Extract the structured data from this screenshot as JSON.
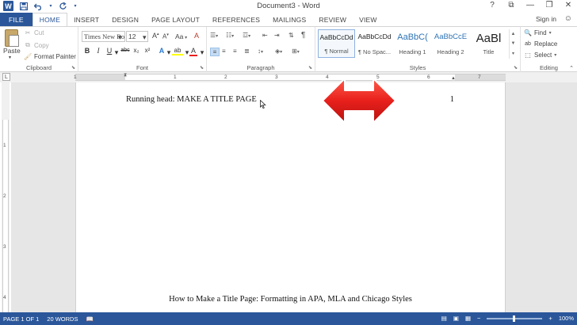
{
  "window": {
    "title": "Document3 - Word",
    "controls": {
      "help": "?",
      "ribbon_display": "⧉",
      "minimize": "—",
      "restore": "❐",
      "close": "✕"
    }
  },
  "quick_access": {
    "app_icon": "W",
    "save_icon": "save-icon",
    "undo_icon": "undo-icon",
    "redo_icon": "redo-icon",
    "customize_icon": "chevron-down-icon"
  },
  "tabs": [
    "FILE",
    "HOME",
    "INSERT",
    "DESIGN",
    "PAGE LAYOUT",
    "REFERENCES",
    "MAILINGS",
    "REVIEW",
    "VIEW"
  ],
  "active_tab": "HOME",
  "sign_in": "Sign in",
  "ribbon": {
    "clipboard": {
      "label": "Clipboard",
      "paste": "Paste",
      "cut": "Cut",
      "copy": "Copy",
      "format_painter": "Format Painter"
    },
    "font": {
      "label": "Font",
      "name": "Times New Ro",
      "size": "12",
      "grow": "A",
      "shrink": "A",
      "case": "Aa",
      "clear": "A",
      "bold": "B",
      "italic": "I",
      "underline": "U",
      "strike": "abc",
      "subscript": "x₂",
      "superscript": "x²",
      "effects": "A",
      "highlight": "ab",
      "color": "A"
    },
    "paragraph": {
      "label": "Paragraph",
      "pilcrow": "¶"
    },
    "styles": {
      "label": "Styles",
      "items": [
        {
          "preview": "AaBbCcDd",
          "name": "¶ Normal"
        },
        {
          "preview": "AaBbCcDd",
          "name": "¶ No Spac..."
        },
        {
          "preview": "AaBbC(",
          "name": "Heading 1"
        },
        {
          "preview": "AaBbCcE",
          "name": "Heading 2"
        },
        {
          "preview": "AaBl",
          "name": "Title"
        }
      ]
    },
    "editing": {
      "label": "Editing",
      "find": "Find",
      "replace": "Replace",
      "select": "Select"
    }
  },
  "ruler": {
    "tab_selector": "L",
    "numbers": [
      "1",
      "1",
      "2",
      "3",
      "4",
      "5",
      "6",
      "7"
    ],
    "vertical_numbers": [
      "1",
      "2",
      "3",
      "4"
    ]
  },
  "document": {
    "header_text": "Running head: MAKE A TITLE PAGE",
    "page_number": "1",
    "title_text": "How to Make a Title Page: Formatting in APA, MLA and Chicago Styles"
  },
  "status": {
    "page": "PAGE 1 OF 1",
    "words": "20 WORDS",
    "zoom": "100%",
    "zoom_level": 1.0
  },
  "colors": {
    "accent": "#2b579a",
    "arrow": "#e8201c"
  }
}
